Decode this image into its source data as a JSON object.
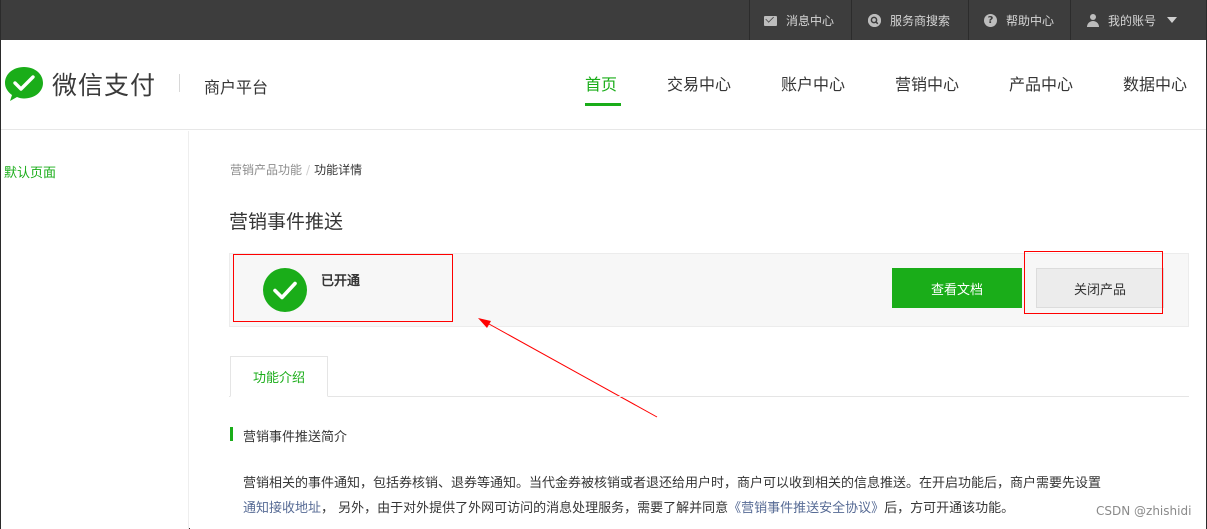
{
  "topbar": {
    "items": [
      {
        "label": "消息中心",
        "icon": "mail-icon"
      },
      {
        "label": "服务商搜索",
        "icon": "search-icon"
      },
      {
        "label": "帮助中心",
        "icon": "help-icon"
      },
      {
        "label": "我的账号",
        "icon": "user-icon"
      }
    ],
    "help_glyph": "?"
  },
  "header": {
    "brand": "微信支付",
    "platform": "商户平台",
    "nav": [
      "首页",
      "交易中心",
      "账户中心",
      "营销中心",
      "产品中心",
      "数据中心"
    ],
    "active_nav": "首页"
  },
  "sidebar": {
    "items": [
      "默认页面"
    ]
  },
  "breadcrumb": {
    "parent": "营销产品功能",
    "separator": "/",
    "current": "功能详情"
  },
  "page": {
    "title": "营销事件推送"
  },
  "status": {
    "label": "已开通",
    "icon": "check-circle-icon"
  },
  "buttons": {
    "docs": "查看文档",
    "close": "关闭产品"
  },
  "tabs": [
    "功能介绍"
  ],
  "section": {
    "title": "营销事件推送简介",
    "line1": "营销相关的事件通知，包括券核销、退券等通知。当代金券被核销或者退还给用户时，商户可以收到相关的信息推送。在开启功能后，商户需要先设置",
    "link1": "通知接收地址",
    "line2_mid": "， 另外，由于对外提供了外网可访问的消息处理服务，需要了解并同意",
    "link2": "《营销事件推送安全协议》",
    "line2_end": "后，方可开通该功能。"
  },
  "watermark": "CSDN @zhishidi",
  "colors": {
    "brand_green": "#1aad19",
    "topbar_bg": "#3d3d3d",
    "link": "#576b95",
    "annotation": "#ff0000"
  }
}
